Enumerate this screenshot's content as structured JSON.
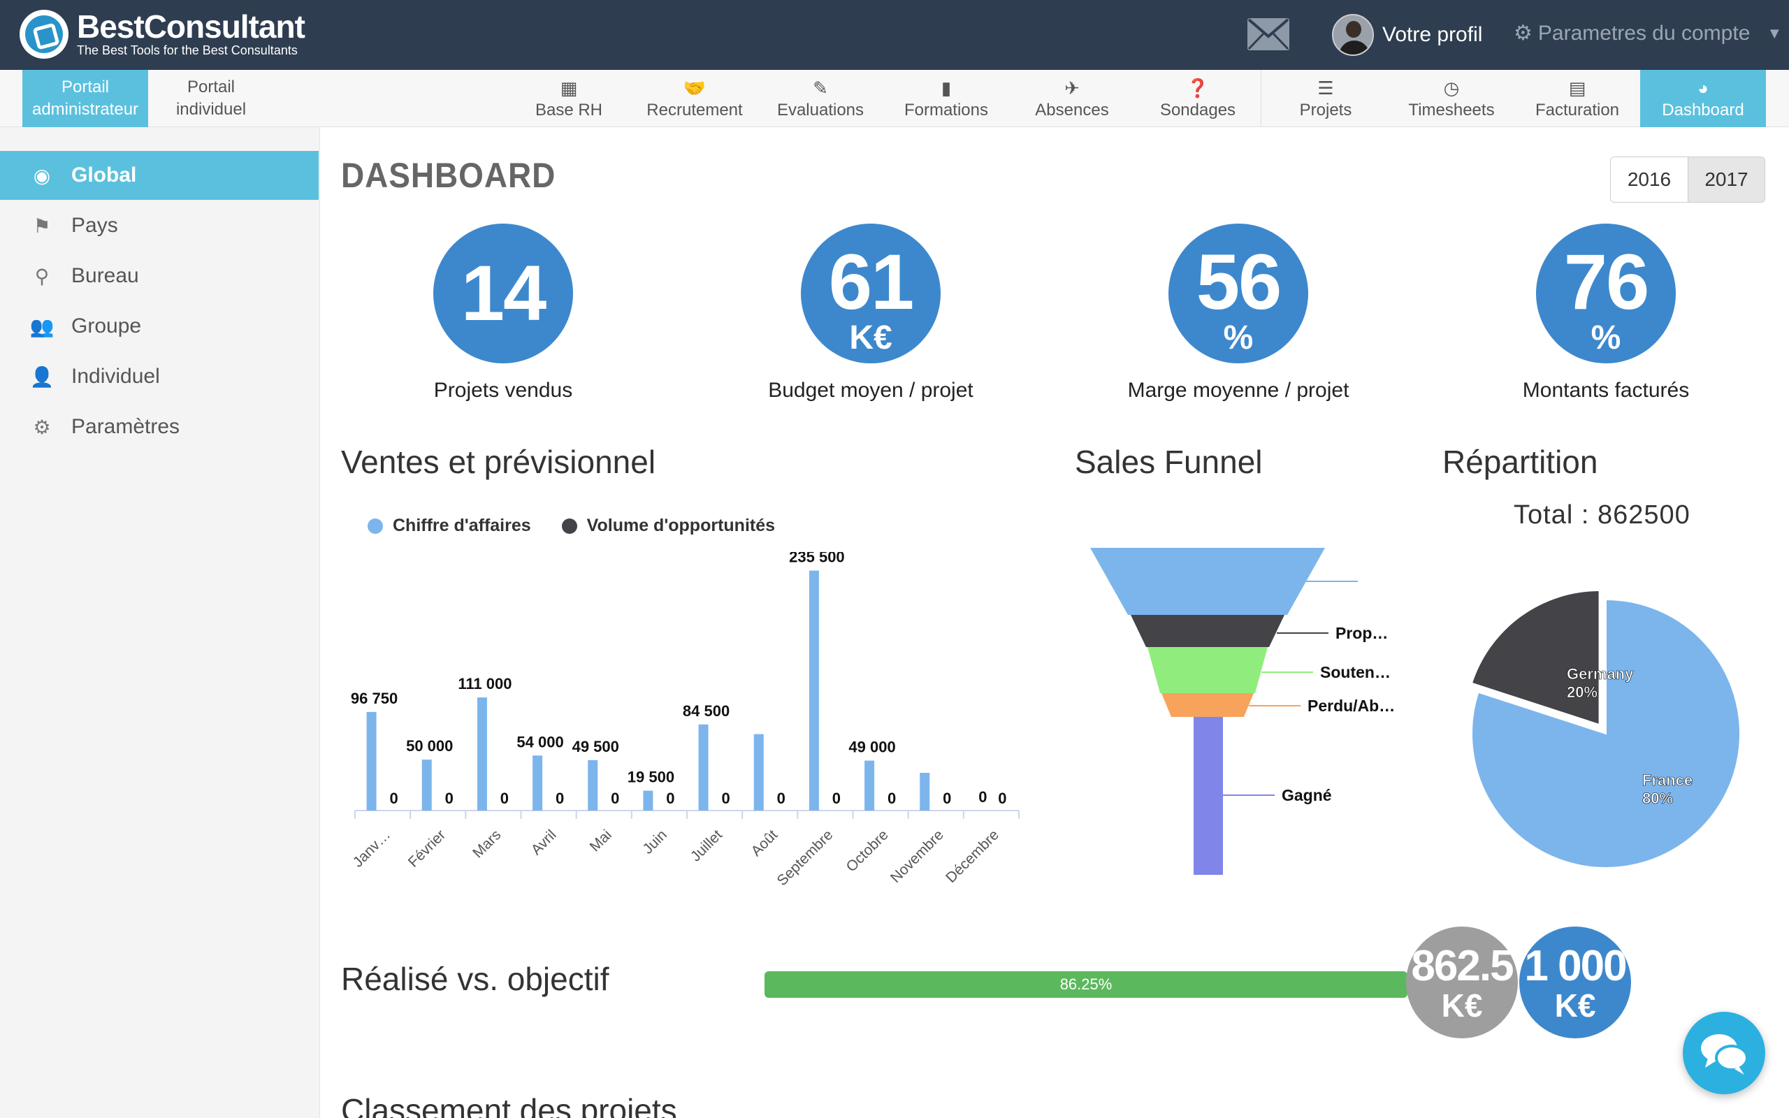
{
  "header": {
    "brand_title": "BestConsultant",
    "brand_subtitle": "The Best Tools for the Best Consultants",
    "profile_label": "Votre profil",
    "account_label": "Parametres du compte"
  },
  "nav": {
    "portals": [
      {
        "line1": "Portail",
        "line2": "administrateur",
        "active": true
      },
      {
        "line1": "Portail",
        "line2": "individuel",
        "active": false
      }
    ],
    "items": [
      {
        "label": "Base RH",
        "icon": "grid-icon"
      },
      {
        "label": "Recrutement",
        "icon": "handshake-icon"
      },
      {
        "label": "Evaluations",
        "icon": "edit-icon"
      },
      {
        "label": "Formations",
        "icon": "book-icon"
      },
      {
        "label": "Absences",
        "icon": "plane-icon"
      },
      {
        "label": "Sondages",
        "icon": "question-icon"
      },
      {
        "label": "Projets",
        "icon": "server-icon"
      },
      {
        "label": "Timesheets",
        "icon": "clock-icon"
      },
      {
        "label": "Facturation",
        "icon": "calculator-icon"
      },
      {
        "label": "Dashboard",
        "icon": "pie-icon",
        "active": true
      }
    ]
  },
  "sidebar": {
    "items": [
      {
        "label": "Global",
        "icon": "globe-icon",
        "active": true
      },
      {
        "label": "Pays",
        "icon": "flag-icon"
      },
      {
        "label": "Bureau",
        "icon": "map-marker-icon"
      },
      {
        "label": "Groupe",
        "icon": "group-icon"
      },
      {
        "label": "Individuel",
        "icon": "user-icon"
      },
      {
        "label": "Paramètres",
        "icon": "gear-icon"
      }
    ]
  },
  "main": {
    "title": "DASHBOARD",
    "years": [
      "2016",
      "2017"
    ],
    "selected_year": "2017",
    "kpis": [
      {
        "value": "14",
        "unit": "",
        "label": "Projets vendus"
      },
      {
        "value": "61",
        "unit": "K€",
        "label": "Budget moyen / projet"
      },
      {
        "value": "56",
        "unit": "%",
        "label": "Marge moyenne / projet"
      },
      {
        "value": "76",
        "unit": "%",
        "label": "Montants facturés"
      }
    ],
    "sections": {
      "sales": "Ventes et prévisionnel",
      "funnel": "Sales Funnel",
      "repartition": "Répartition",
      "realise": "Réalisé vs. objectif",
      "classement": "Classement des projets"
    },
    "total_label": "Total : 862500"
  },
  "chart_data": [
    {
      "type": "bar",
      "categories": [
        "Janv…",
        "Février",
        "Mars",
        "Avril",
        "Mai",
        "Juin",
        "Juillet",
        "Août",
        "Septembre",
        "Octobre",
        "Novembre",
        "Décembre"
      ],
      "series": [
        {
          "name": "Chiffre d'affaires",
          "color": "#7cb5ec",
          "values": [
            96750,
            50000,
            111000,
            54000,
            49500,
            19500,
            84500,
            75000,
            235500,
            49000,
            37000,
            0
          ],
          "labels": [
            "96 750",
            "50 000",
            "111 000",
            "54 000",
            "49 500",
            "19 500",
            "84 500",
            "",
            "235 500",
            "49 000",
            "",
            "0"
          ]
        },
        {
          "name": "Volume d'opportunités",
          "color": "#434348",
          "values": [
            0,
            0,
            0,
            0,
            0,
            0,
            0,
            0,
            0,
            0,
            0,
            0
          ],
          "labels": [
            "0",
            "0",
            "0",
            "0",
            "0",
            "0",
            "0",
            "0",
            "0",
            "0",
            "0",
            "0"
          ]
        }
      ],
      "ylim": [
        0,
        240000
      ],
      "legend": "top-left"
    },
    {
      "type": "funnel",
      "stages": [
        {
          "label": "",
          "color": "#7cb5ec"
        },
        {
          "label": "Prop…",
          "color": "#434348"
        },
        {
          "label": "Souten…",
          "color": "#90ed7d"
        },
        {
          "label": "Perdu/Ab…",
          "color": "#f7a35c"
        },
        {
          "label": "Gagné",
          "color": "#8085e9"
        }
      ]
    },
    {
      "type": "pie",
      "slices": [
        {
          "label": "France",
          "percent": "80%",
          "value": 80,
          "color": "#7cb5ec"
        },
        {
          "label": "Germany",
          "percent": "20%",
          "value": 20,
          "color": "#434348"
        }
      ]
    }
  ],
  "realise": {
    "percent_label": "86.25%",
    "progress": 86.25,
    "achieved_value": "862.5",
    "achieved_unit": "K€",
    "objective_value": "1 000",
    "objective_unit": "K€"
  },
  "colors": {
    "header_bg": "#2e3d50",
    "accent": "#5bc0de",
    "kpi_blue": "#3d88cd",
    "progress_green": "#5cb85c",
    "gauge_grey": "#9e9e9e",
    "chat_blue": "#2cb0e0"
  }
}
